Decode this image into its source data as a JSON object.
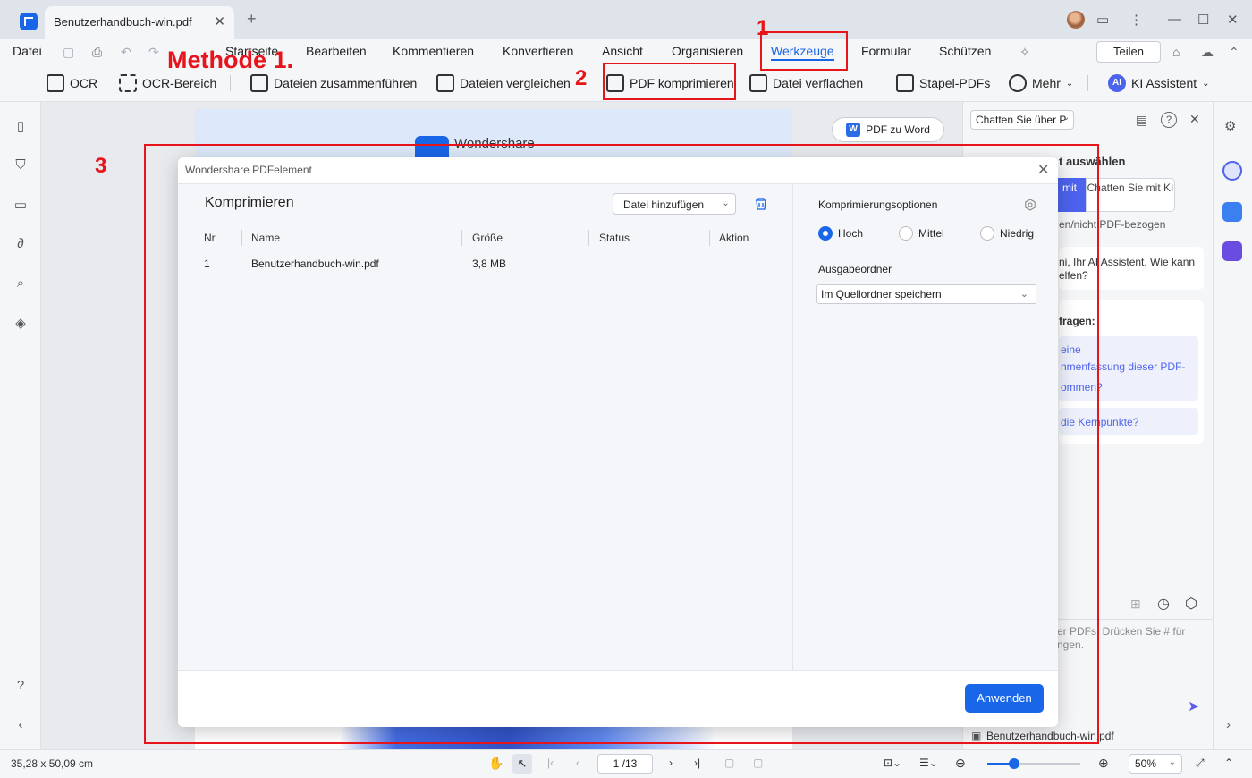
{
  "app": {
    "tab_title": "Benutzerhandbuch-win.pdf"
  },
  "menu": {
    "file": "Datei",
    "items": [
      "Startseite",
      "Bearbeiten",
      "Kommentieren",
      "Konvertieren",
      "Ansicht",
      "Organisieren",
      "Werkzeuge",
      "Formular",
      "Schützen"
    ],
    "share": "Teilen"
  },
  "toolbar": {
    "ocr": "OCR",
    "ocr_area": "OCR-Bereich",
    "merge": "Dateien zusammenführen",
    "compare": "Dateien vergleichen",
    "compress": "PDF komprimieren",
    "flatten": "Datei verflachen",
    "batch": "Stapel-PDFs",
    "more": "Mehr",
    "ai": "KI Assistent"
  },
  "annotations": {
    "method": "Methode 1.",
    "step1": "1",
    "step2": "2",
    "step3": "3",
    "color": "#e8141c"
  },
  "document": {
    "brand": "Wondershare",
    "convert_button": "PDF zu Word"
  },
  "dialog": {
    "title": "Wondershare PDFelement",
    "heading": "Komprimieren",
    "add_file": "Datei hinzufügen",
    "columns": [
      "Nr.",
      "Name",
      "Größe",
      "Status",
      "Aktion"
    ],
    "rows": [
      {
        "nr": "1",
        "name": "Benutzerhandbuch-win.pdf",
        "size": "3,8 MB",
        "status": "",
        "action": ""
      }
    ],
    "options_heading": "Komprimierungsoptionen",
    "levels": [
      "Hoch",
      "Mittel",
      "Niedrig"
    ],
    "selected_level": "Hoch",
    "output_heading": "Ausgabeordner",
    "output_value": "Im Quellordner speichern",
    "apply": "Anwenden"
  },
  "ai_panel": {
    "chat_select": "Chatten Sie über P",
    "select_heading": "t auswählen",
    "mode_active": "mit",
    "mode_other": "Chatten Sie mit KI",
    "pdf_related": "en/nicht PDF-bezogen",
    "greeting_line1": "ni, Ihr AI Assistent. Wie kann",
    "greeting_line2": "elfen?",
    "questions_heading": "fragen:",
    "suggestion1_line1": "eine",
    "suggestion1_line2": "nmenfassung dieser PDF-",
    "suggestion1_line3": "ommen?",
    "suggestion2": "die Kernpunkte?",
    "input_line1": "er PDFs. Drücken Sie # für",
    "input_line2": "ngen.",
    "file_chip": "Benutzerhandbuch-win.pdf"
  },
  "status": {
    "dimensions": "35,28 x 50,09 cm",
    "page": "1 /13",
    "zoom": "50%",
    "zoom_level": 0.29
  },
  "colors": {
    "accent": "#1a66e8",
    "ai_purple": "#4d63ee"
  }
}
